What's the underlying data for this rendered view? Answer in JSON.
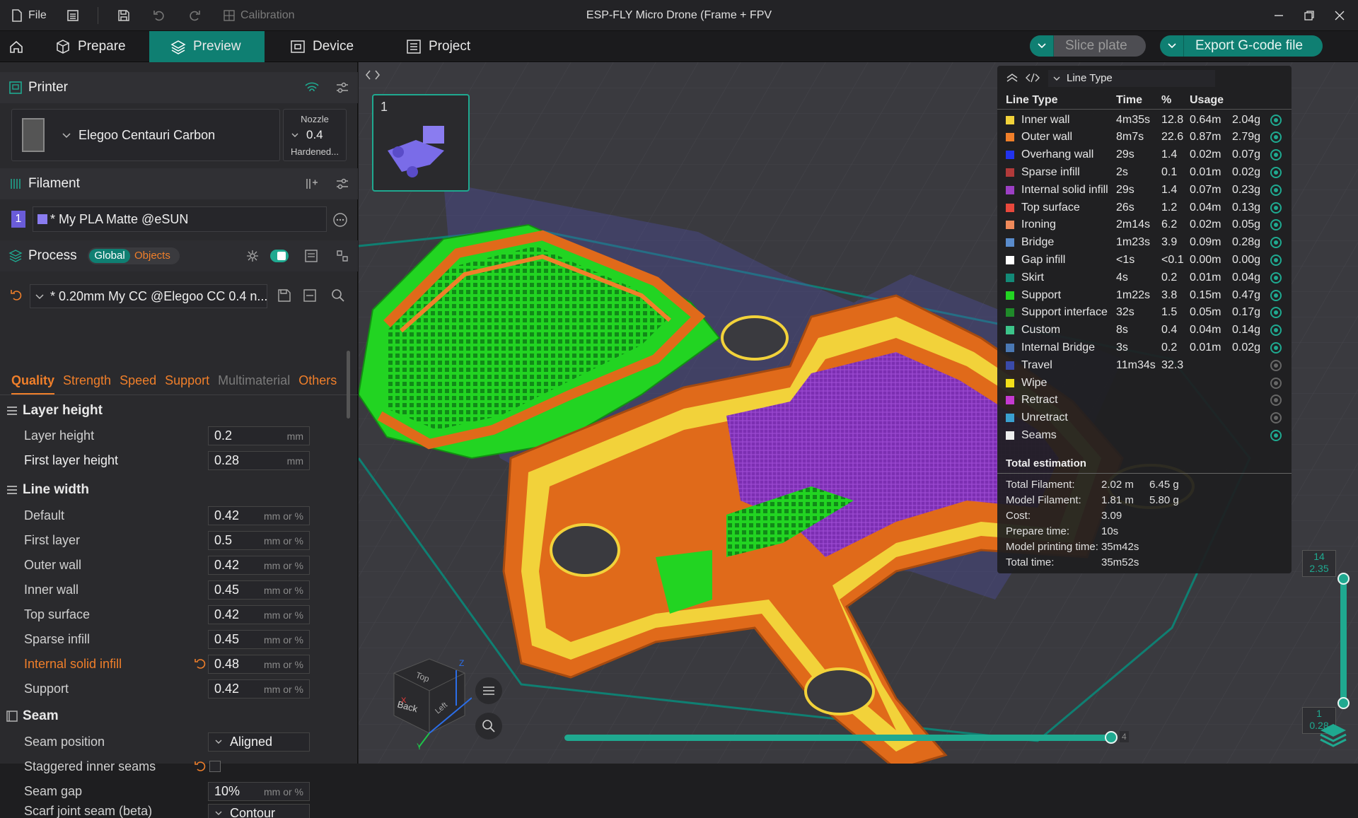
{
  "titlebar": {
    "file": "File",
    "calibration": "Calibration",
    "title": "ESP-FLY Micro Drone (Frame + FPV"
  },
  "tabs": [
    "Prepare",
    "Preview",
    "Device",
    "Project"
  ],
  "actions": {
    "slice": "Slice plate",
    "export": "Export G-code file"
  },
  "printer": {
    "header": "Printer",
    "name": "Elegoo Centauri Carbon",
    "nozzle_label": "Nozzle",
    "nozzle_value": "0.4",
    "nozzle_type": "Hardened..."
  },
  "filament": {
    "header": "Filament",
    "index": "1",
    "name": "* My PLA Matte @eSUN",
    "color": "#8a7cf0"
  },
  "process": {
    "header": "Process",
    "global": "Global",
    "objects": "Objects",
    "preset": "* 0.20mm My CC @Elegoo CC 0.4 n..."
  },
  "subtabs": [
    "Quality",
    "Strength",
    "Speed",
    "Support",
    "Multimaterial",
    "Others"
  ],
  "groups": {
    "layer_height": "Layer height",
    "line_width": "Line width",
    "seam": "Seam"
  },
  "layer_height_opts": [
    {
      "label": "Layer height",
      "value": "0.2",
      "unit": "mm"
    },
    {
      "label": "First layer height",
      "value": "0.28",
      "unit": "mm"
    }
  ],
  "line_width_opts": [
    {
      "label": "Default",
      "value": "0.42",
      "unit": "mm or %"
    },
    {
      "label": "First layer",
      "value": "0.5",
      "unit": "mm or %"
    },
    {
      "label": "Outer wall",
      "value": "0.42",
      "unit": "mm or %"
    },
    {
      "label": "Inner wall",
      "value": "0.45",
      "unit": "mm or %"
    },
    {
      "label": "Top surface",
      "value": "0.42",
      "unit": "mm or %"
    },
    {
      "label": "Sparse infill",
      "value": "0.45",
      "unit": "mm or %"
    },
    {
      "label": "Internal solid infill",
      "value": "0.48",
      "unit": "mm or %"
    },
    {
      "label": "Support",
      "value": "0.42",
      "unit": "mm or %"
    }
  ],
  "seam_opts": {
    "position_label": "Seam position",
    "position_value": "Aligned",
    "staggered_label": "Staggered inner seams",
    "gap_label": "Seam gap",
    "gap_value": "10%",
    "gap_unit": "mm or %",
    "scarf_label": "Scarf joint seam (beta)",
    "scarf_value": "Contour"
  },
  "plate": {
    "number": "1"
  },
  "legend": {
    "title": "Line Type",
    "headers": {
      "type": "Line Type",
      "time": "Time",
      "pct": "%",
      "usage": "Usage"
    },
    "rows": [
      {
        "name": "Inner wall",
        "color": "#f2d23a",
        "time": "4m35s",
        "pct": "12.8",
        "len": "0.64m",
        "wt": "2.04g",
        "visible": true
      },
      {
        "name": "Outer wall",
        "color": "#f07f2a",
        "time": "8m7s",
        "pct": "22.6",
        "len": "0.87m",
        "wt": "2.79g",
        "visible": true
      },
      {
        "name": "Overhang wall",
        "color": "#2233ee",
        "time": "29s",
        "pct": "1.4",
        "len": "0.02m",
        "wt": "0.07g",
        "visible": true
      },
      {
        "name": "Sparse infill",
        "color": "#b23a3a",
        "time": "2s",
        "pct": "0.1",
        "len": "0.01m",
        "wt": "0.02g",
        "visible": true
      },
      {
        "name": "Internal solid infill",
        "color": "#9c3fc4",
        "time": "29s",
        "pct": "1.4",
        "len": "0.07m",
        "wt": "0.23g",
        "visible": true
      },
      {
        "name": "Top surface",
        "color": "#e8483c",
        "time": "26s",
        "pct": "1.2",
        "len": "0.04m",
        "wt": "0.13g",
        "visible": true
      },
      {
        "name": "Ironing",
        "color": "#f08a5a",
        "time": "2m14s",
        "pct": "6.2",
        "len": "0.02m",
        "wt": "0.05g",
        "visible": true
      },
      {
        "name": "Bridge",
        "color": "#5a8ccc",
        "time": "1m23s",
        "pct": "3.9",
        "len": "0.09m",
        "wt": "0.28g",
        "visible": true
      },
      {
        "name": "Gap infill",
        "color": "#ffffff",
        "time": "<1s",
        "pct": "<0.1",
        "len": "0.00m",
        "wt": "0.00g",
        "visible": true
      },
      {
        "name": "Skirt",
        "color": "#138a78",
        "time": "4s",
        "pct": "0.2",
        "len": "0.01m",
        "wt": "0.04g",
        "visible": true
      },
      {
        "name": "Support",
        "color": "#22d422",
        "time": "1m22s",
        "pct": "3.8",
        "len": "0.15m",
        "wt": "0.47g",
        "visible": true
      },
      {
        "name": "Support interface",
        "color": "#1f8a2a",
        "time": "32s",
        "pct": "1.5",
        "len": "0.05m",
        "wt": "0.17g",
        "visible": true
      },
      {
        "name": "Custom",
        "color": "#3cc48a",
        "time": "8s",
        "pct": "0.4",
        "len": "0.04m",
        "wt": "0.14g",
        "visible": true
      },
      {
        "name": "Internal Bridge",
        "color": "#4a78b4",
        "time": "3s",
        "pct": "0.2",
        "len": "0.01m",
        "wt": "0.02g",
        "visible": true
      },
      {
        "name": "Travel",
        "color": "#3a4aa8",
        "time": "11m34s",
        "pct": "32.3",
        "len": "",
        "wt": "",
        "visible": false
      },
      {
        "name": "Wipe",
        "color": "#f2e01a",
        "time": "",
        "pct": "",
        "len": "",
        "wt": "",
        "visible": false
      },
      {
        "name": "Retract",
        "color": "#c43ad0",
        "time": "",
        "pct": "",
        "len": "",
        "wt": "",
        "visible": false
      },
      {
        "name": "Unretract",
        "color": "#3aa0d0",
        "time": "",
        "pct": "",
        "len": "",
        "wt": "",
        "visible": false
      },
      {
        "name": "Seams",
        "color": "#eeeeee",
        "time": "",
        "pct": "",
        "len": "",
        "wt": "",
        "visible": true
      }
    ],
    "total_title": "Total estimation",
    "totals": [
      {
        "label": "Total Filament:",
        "v1": "2.02 m",
        "v2": "6.45 g"
      },
      {
        "label": "Model Filament:",
        "v1": "1.81 m",
        "v2": "5.80 g"
      },
      {
        "label": "Cost:",
        "v1": "3.09",
        "v2": ""
      },
      {
        "label": "Prepare time:",
        "v1": "10s",
        "v2": ""
      },
      {
        "label": "Model printing time:",
        "v1": "35m42s",
        "v2": ""
      },
      {
        "label": "Total time:",
        "v1": "35m52s",
        "v2": ""
      }
    ]
  },
  "layer_slider": {
    "top_layer": "14",
    "top_height": "2.35",
    "bottom_layer": "1",
    "bottom_height": "0.28"
  },
  "move_slider": {
    "value": "4"
  },
  "nav_cube": {
    "top": "Top",
    "back": "Back",
    "left": "Left",
    "x": "X",
    "y": "Y",
    "z": "Z"
  },
  "colors": {
    "accent": "#0f7f72",
    "teal": "#1fa990",
    "orange": "#f07f2a"
  }
}
